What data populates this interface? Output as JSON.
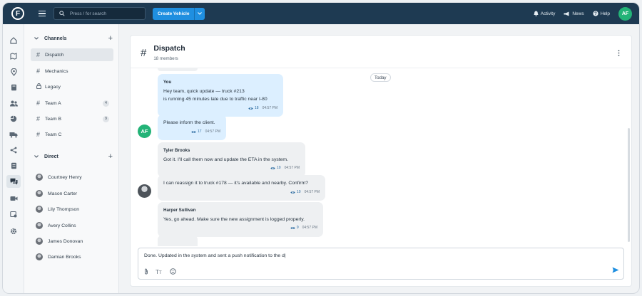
{
  "topbar": {
    "logo_letter": "F",
    "search_placeholder": "Press / for search",
    "create_label": "Create Vehicle",
    "links": {
      "activity": "Activity",
      "news": "News",
      "help": "Help"
    },
    "user_initials": "AF"
  },
  "sidebar": {
    "channels_header": "Channels",
    "channels": [
      {
        "label": "Dispatch",
        "icon": "hash",
        "active": true
      },
      {
        "label": "Mechanics",
        "icon": "hash"
      },
      {
        "label": "Legacy",
        "icon": "lock"
      },
      {
        "label": "Team A",
        "icon": "hash",
        "count": "4"
      },
      {
        "label": "Team B",
        "icon": "hash",
        "count": "9"
      },
      {
        "label": "Team C",
        "icon": "hash"
      }
    ],
    "direct_header": "Direct",
    "direct": [
      {
        "label": "Courtney Henry"
      },
      {
        "label": "Mason Carter"
      },
      {
        "label": "Lily Thompson"
      },
      {
        "label": "Avery Collins"
      },
      {
        "label": "James Donovan"
      },
      {
        "label": "Damian Brooks"
      }
    ]
  },
  "channel": {
    "title": "Dispatch",
    "members": "18 members",
    "date_divider": "Today"
  },
  "messages": [
    {
      "author": "You",
      "line1": "Hey team, quick update — truck #213",
      "line2": "is running 45 minutes late due to traffic near I-80",
      "seen": "18",
      "time": "04:57 PM"
    },
    {
      "text": "Please inform the client.",
      "seen": "17",
      "time": "04:57 PM"
    },
    {
      "author": "Tyler Brooks",
      "text": "Got it. I'll call them now and update the ETA in the system.",
      "seen": "10",
      "time": "04:57 PM"
    },
    {
      "text": "I can reassign it to truck #178 — it's available and nearby. Confirm?",
      "seen": "10",
      "time": "04:57 PM"
    },
    {
      "author": "Harper Sullivan",
      "text": "Yes, go ahead. Make sure the new assignment is logged properly.",
      "seen": "9",
      "time": "04:57 PM"
    }
  ],
  "composer": {
    "value": "Done. Updated in the system and sent a push notification to the d|"
  },
  "colors": {
    "topbar": "#1e3a52",
    "accent": "#1f8fe0",
    "avatar_green": "#23b377",
    "bubble_you": "#dcefff"
  }
}
